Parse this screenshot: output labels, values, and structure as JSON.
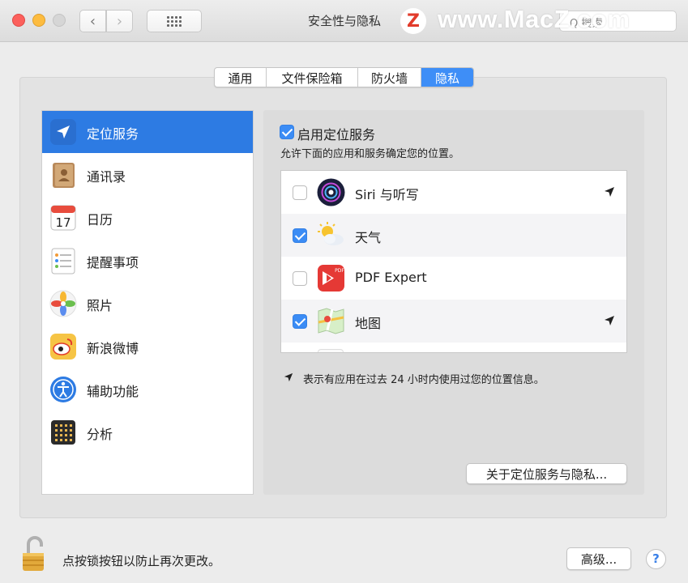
{
  "window": {
    "title": "安全性与隐私",
    "search_placeholder": "Q 搜索"
  },
  "watermark": {
    "letter": "Z",
    "text": "www.MacZ.com"
  },
  "tabs": [
    {
      "label": "通用",
      "active": false
    },
    {
      "label": "文件保险箱",
      "active": false
    },
    {
      "label": "防火墙",
      "active": false
    },
    {
      "label": "隐私",
      "active": true
    }
  ],
  "sidebar": {
    "items": [
      {
        "label": "定位服务",
        "icon": "location-arrow-icon",
        "selected": true
      },
      {
        "label": "通讯录",
        "icon": "contacts-book-icon",
        "selected": false
      },
      {
        "label": "日历",
        "icon": "calendar-icon",
        "selected": false
      },
      {
        "label": "提醒事项",
        "icon": "reminders-icon",
        "selected": false
      },
      {
        "label": "照片",
        "icon": "photos-icon",
        "selected": false
      },
      {
        "label": "新浪微博",
        "icon": "weibo-icon",
        "selected": false
      },
      {
        "label": "辅助功能",
        "icon": "accessibility-icon",
        "selected": false
      },
      {
        "label": "分析",
        "icon": "analytics-icon",
        "selected": false
      }
    ]
  },
  "location": {
    "enable_label": "启用定位服务",
    "enabled": true,
    "description": "允许下面的应用和服务确定您的位置。",
    "apps": [
      {
        "name": "Siri 与听写",
        "checked": false,
        "recent_use": true,
        "icon": "siri-icon"
      },
      {
        "name": "天气",
        "checked": true,
        "recent_use": false,
        "icon": "weather-icon"
      },
      {
        "name": "PDF Expert",
        "checked": false,
        "recent_use": false,
        "icon": "pdf-expert-icon"
      },
      {
        "name": "地图",
        "checked": true,
        "recent_use": true,
        "icon": "maps-icon"
      }
    ],
    "note": "表示有应用在过去 24 小时内使用过您的位置信息。",
    "about_button": "关于定位服务与隐私..."
  },
  "footer": {
    "lock_text": "点按锁按钮以防止再次更改。",
    "advanced_button": "高级...",
    "help": "?"
  },
  "colors": {
    "accent": "#2d7be3",
    "checkbox": "#3b8cf5"
  }
}
